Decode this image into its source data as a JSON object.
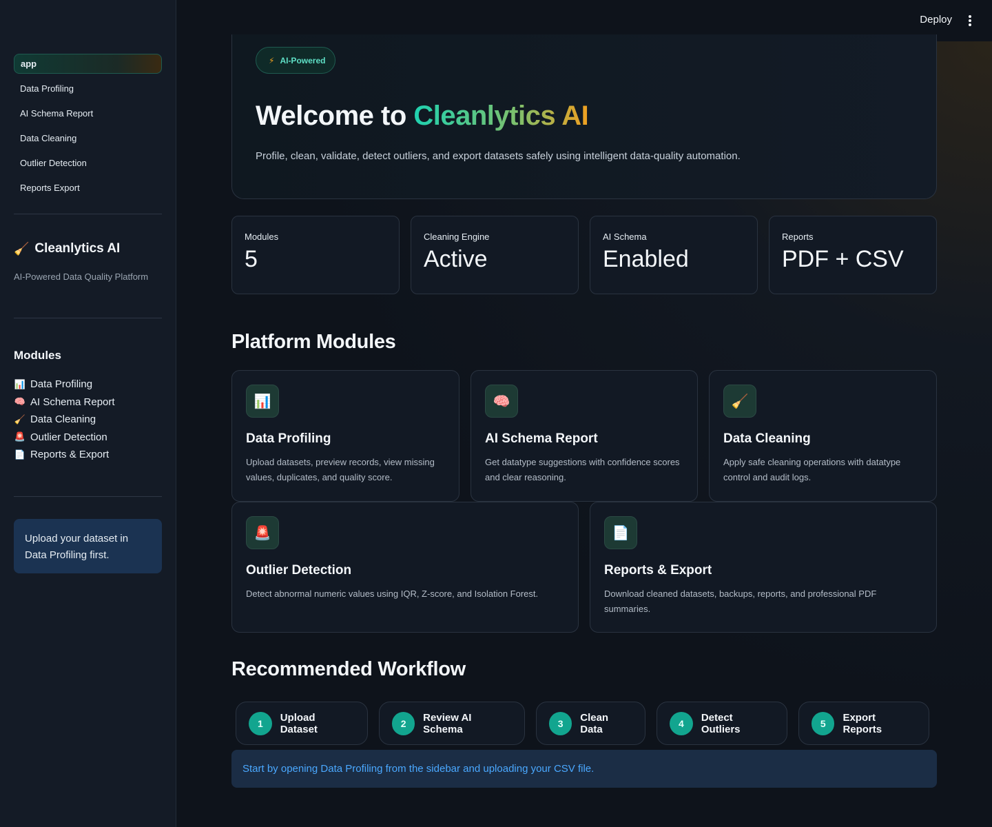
{
  "sidebar": {
    "nav": [
      {
        "label": "app",
        "active": true
      },
      {
        "label": "Data Profiling"
      },
      {
        "label": "AI Schema Report"
      },
      {
        "label": "Data Cleaning"
      },
      {
        "label": "Outlier Detection"
      },
      {
        "label": "Reports Export"
      }
    ],
    "brand_icon": "🧹",
    "brand_title": "Cleanlytics AI",
    "brand_subtitle": "AI-Powered Data Quality Platform",
    "modules_heading": "Modules",
    "modules": [
      {
        "icon": "📊",
        "label": "Data Profiling"
      },
      {
        "icon": "🧠",
        "label": "AI Schema Report"
      },
      {
        "icon": "🧹",
        "label": "Data Cleaning"
      },
      {
        "icon": "🚨",
        "label": "Outlier Detection"
      },
      {
        "icon": "📄",
        "label": "Reports & Export"
      }
    ],
    "tip": "Upload your dataset in Data Profiling first."
  },
  "header": {
    "deploy_label": "Deploy"
  },
  "hero": {
    "pill_icon": "⚡",
    "pill_label": "AI-Powered",
    "title_prefix": "Welcome to ",
    "title_brand": "Cleanlytics AI",
    "description": "Profile, clean, validate, detect outliers, and export datasets safely using intelligent data-quality automation."
  },
  "stats": [
    {
      "label": "Modules",
      "value": "5"
    },
    {
      "label": "Cleaning Engine",
      "value": "Active"
    },
    {
      "label": "AI Schema",
      "value": "Enabled"
    },
    {
      "label": "Reports",
      "value": "PDF + CSV"
    }
  ],
  "modules_section": {
    "heading": "Platform Modules",
    "cards": [
      {
        "icon": "📊",
        "title": "Data Profiling",
        "desc": "Upload datasets, preview records, view missing values, duplicates, and quality score."
      },
      {
        "icon": "🧠",
        "title": "AI Schema Report",
        "desc": "Get datatype suggestions with confidence scores and clear reasoning."
      },
      {
        "icon": "🧹",
        "title": "Data Cleaning",
        "desc": "Apply safe cleaning operations with datatype control and audit logs."
      },
      {
        "icon": "🚨",
        "title": "Outlier Detection",
        "desc": "Detect abnormal numeric values using IQR, Z-score, and Isolation Forest."
      },
      {
        "icon": "📄",
        "title": "Reports & Export",
        "desc": "Download cleaned datasets, backups, reports, and professional PDF summaries."
      }
    ]
  },
  "workflow": {
    "heading": "Recommended Workflow",
    "steps": [
      {
        "num": "1",
        "label": "Upload Dataset"
      },
      {
        "num": "2",
        "label": "Review AI Schema"
      },
      {
        "num": "3",
        "label": "Clean Data"
      },
      {
        "num": "4",
        "label": "Detect Outliers"
      },
      {
        "num": "5",
        "label": "Export Reports"
      }
    ],
    "info": "Start by opening Data Profiling from the sidebar and uploading your CSV file."
  }
}
